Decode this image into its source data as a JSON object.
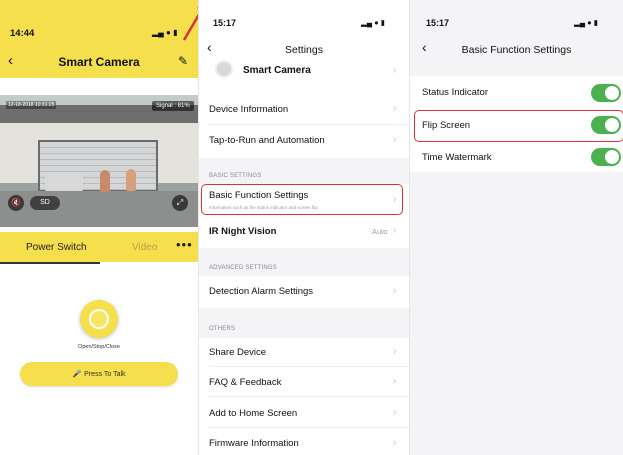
{
  "camera_screen": {
    "time": "14:44",
    "status_icons": "▂▄ ● ▮",
    "back_icon": "chevron-left-icon",
    "title": "Smart Camera",
    "edit_icon": "pencil-icon",
    "video": {
      "timestamp": "12-18-2018  10:31:25",
      "signal": "Signal : 81%",
      "quality": "SD"
    },
    "tabs": {
      "power_switch": "Power Switch",
      "video": "Video",
      "more": "•••"
    },
    "knob_label": "Open/Stop/Close",
    "talk_button": "Press To Talk",
    "accent": "#f5df4d"
  },
  "settings_screen": {
    "time": "15:17",
    "status_icons": "▂▄ ● ▮",
    "title": "Settings",
    "device_name": "Smart Camera",
    "rows": {
      "device_information": "Device Information",
      "tap_to_run": "Tap-to-Run and Automation",
      "basic_function_settings": "Basic Function Settings",
      "basic_function_sub": "Information such as the status indicator and screen flip",
      "ir_night_vision": "IR Night Vision",
      "ir_night_vision_value": "Auto",
      "detection_alarm": "Detection Alarm Settings",
      "share_device": "Share Device",
      "faq": "FAQ & Feedback",
      "add_home": "Add to Home Screen",
      "firmware": "Firmware Information"
    },
    "sections": {
      "basic": "BASIC SETTINGS",
      "advanced": "ADVANCED SETTINGS",
      "others": "OTHERS"
    },
    "chevron": "›"
  },
  "basic_function_screen": {
    "time": "15:17",
    "status_icons": "▂▄ ● ▮",
    "title": "Basic Function Settings",
    "rows": [
      {
        "label": "Status Indicator",
        "enabled": true
      },
      {
        "label": "Flip Screen",
        "enabled": true
      },
      {
        "label": "Time Watermark",
        "enabled": true
      }
    ],
    "toggle_color": "#4caf50",
    "highlight_color": "#d2353a"
  }
}
